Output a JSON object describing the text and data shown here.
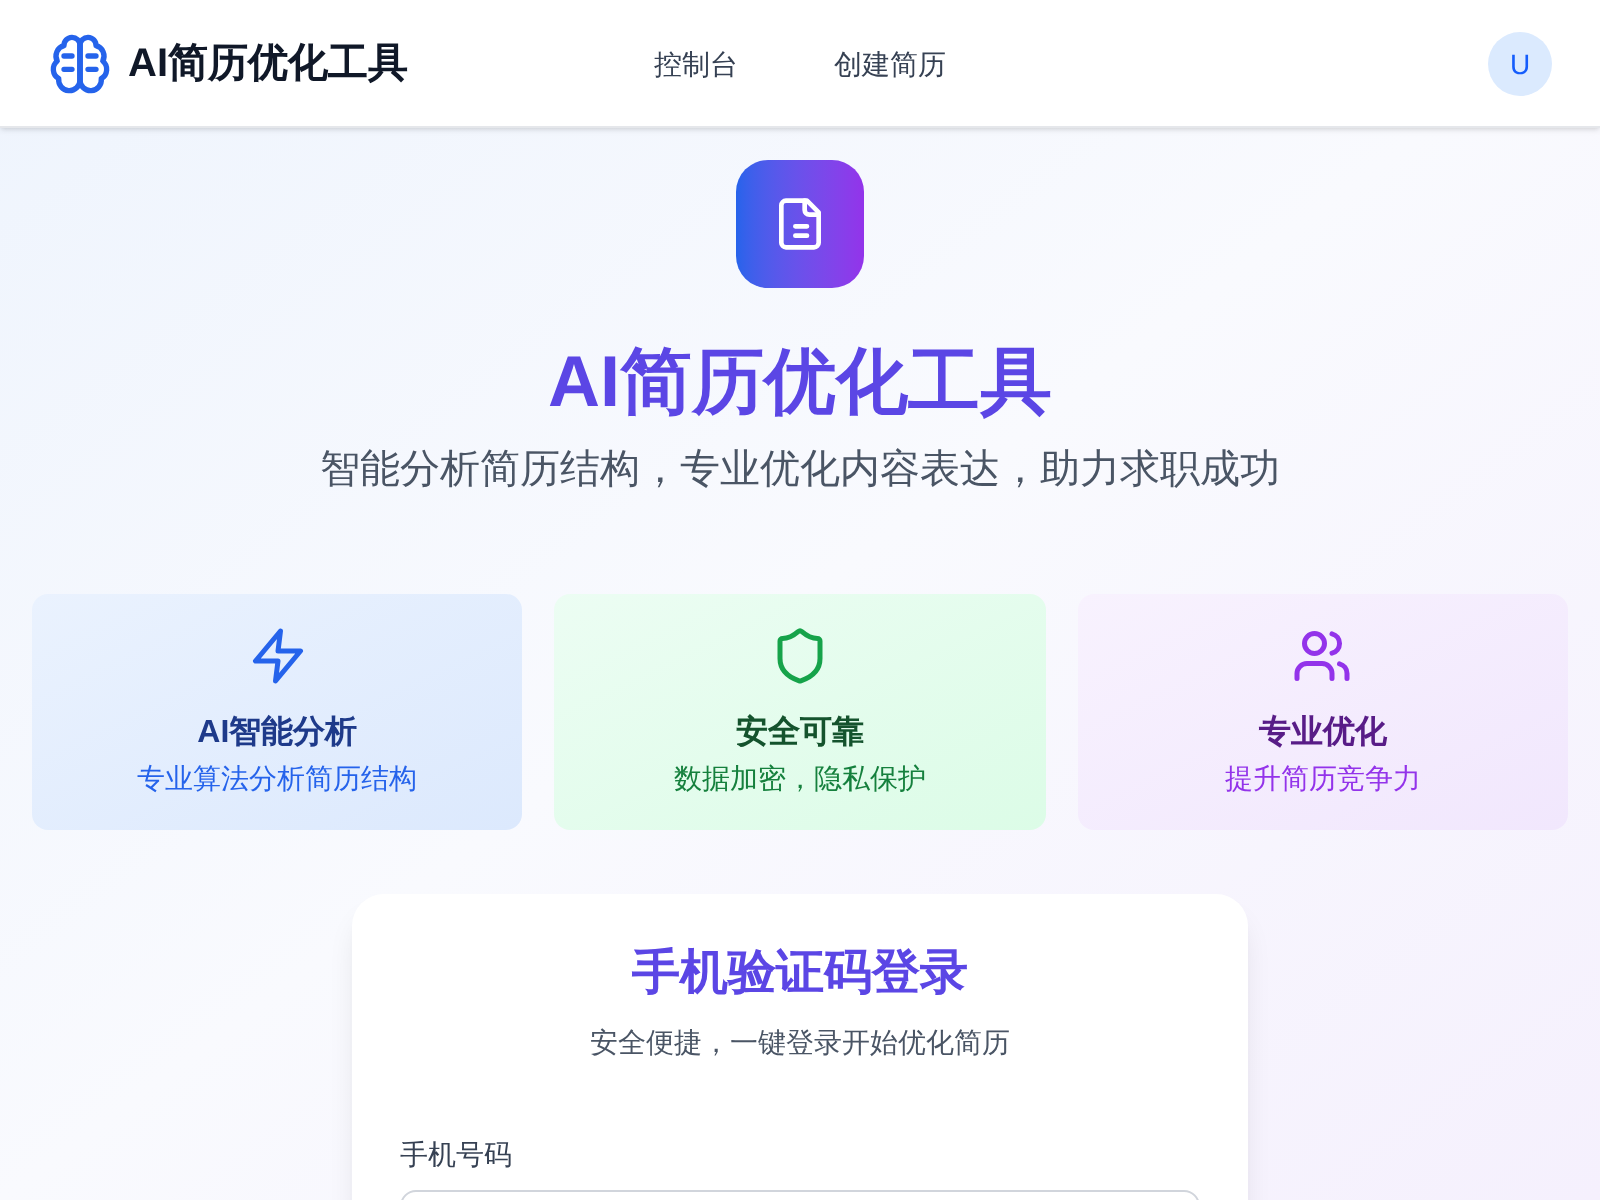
{
  "header": {
    "brand": "AI简历优化工具",
    "nav": [
      {
        "label": "控制台"
      },
      {
        "label": "创建简历"
      }
    ],
    "avatar": "U"
  },
  "hero": {
    "title": "AI简历优化工具",
    "subtitle": "智能分析简历结构，专业优化内容表达，助力求职成功"
  },
  "features": [
    {
      "kind": "speed",
      "title": "AI智能分析",
      "text": "专业算法分析简历结构"
    },
    {
      "kind": "security",
      "title": "安全可靠",
      "text": "数据加密，隐私保护"
    },
    {
      "kind": "people",
      "title": "专业优化",
      "text": "提升简历竞争力"
    }
  ],
  "login": {
    "title": "手机验证码登录",
    "subtitle": "安全便捷，一键登录开始优化简历",
    "phone_label": "手机号码"
  }
}
